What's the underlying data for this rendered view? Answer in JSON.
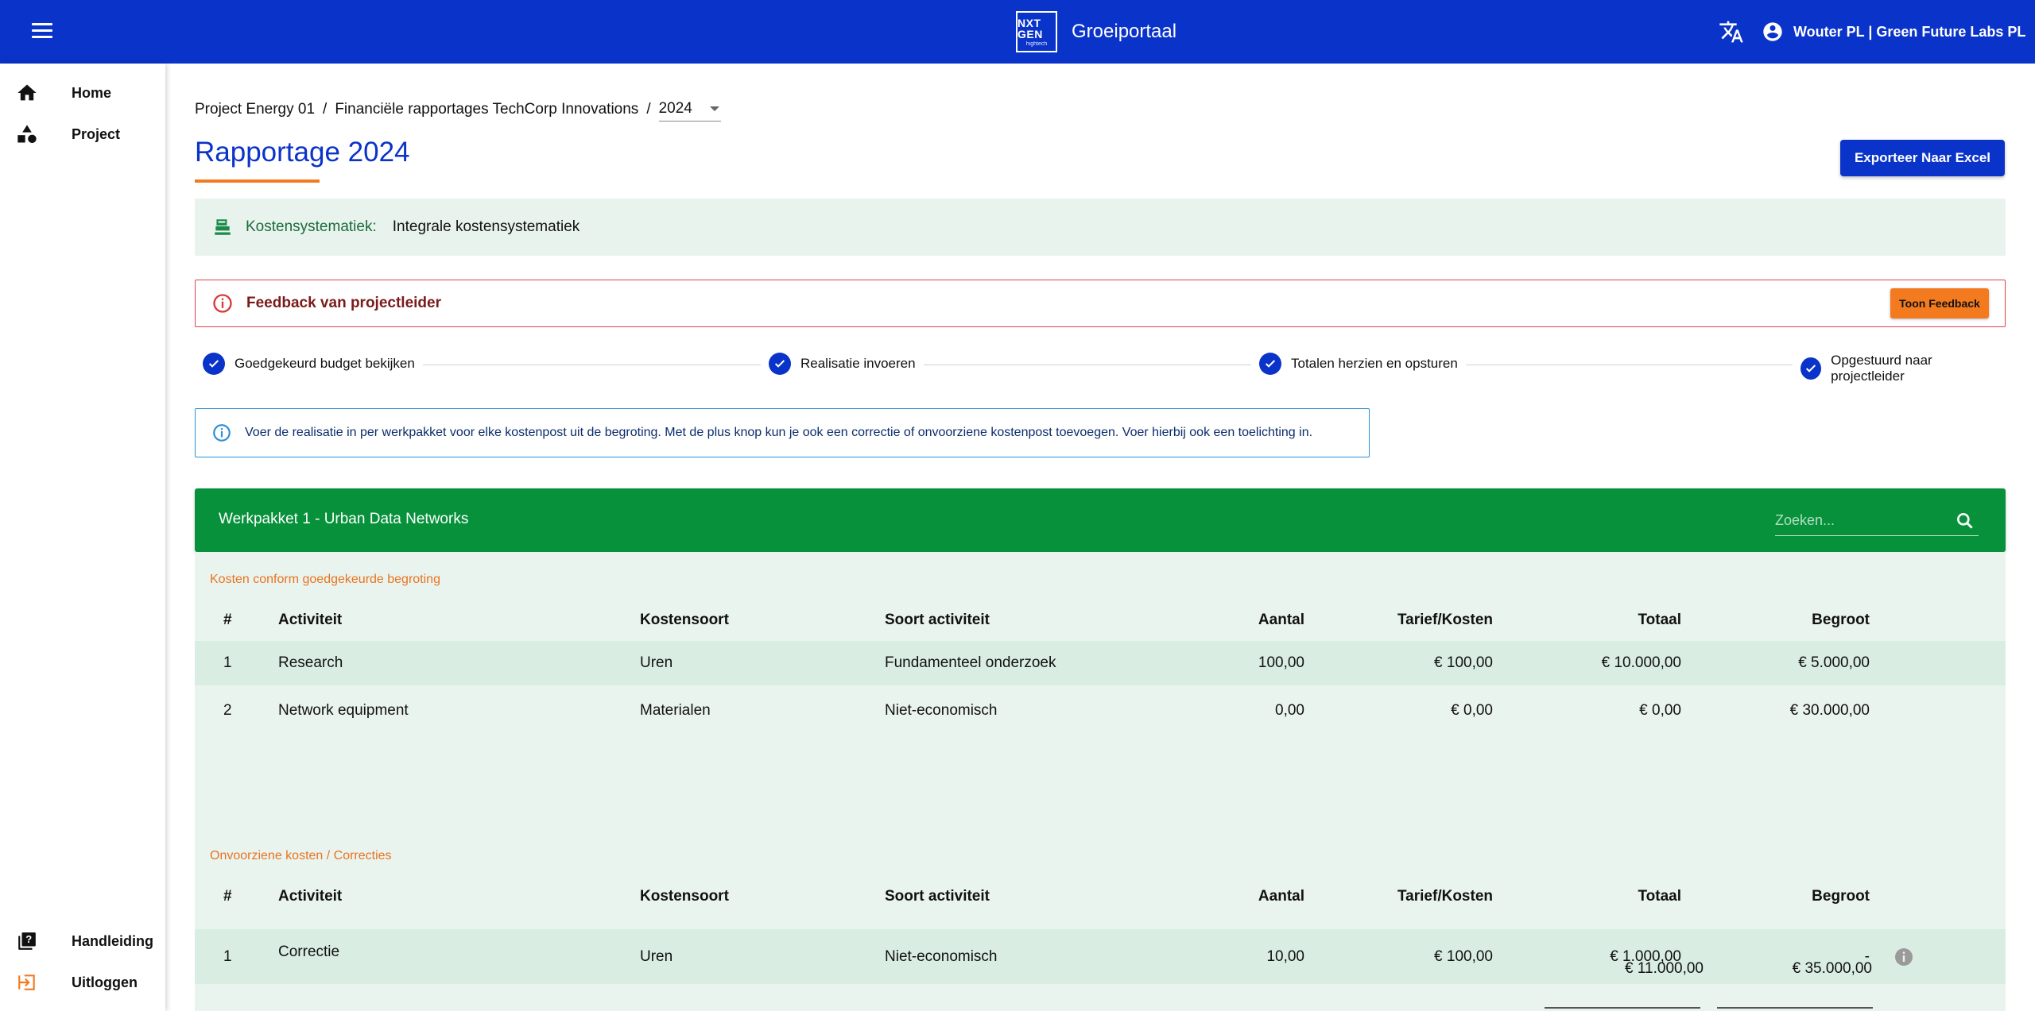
{
  "app": {
    "title": "Groeiportaal",
    "logo_line1": "NXT GEN",
    "logo_line2": "hightech",
    "user": "Wouter PL | Green Future Labs PL"
  },
  "sidebar": {
    "items": [
      {
        "label": "Home",
        "icon": "home-icon"
      },
      {
        "label": "Project",
        "icon": "shapes-icon"
      }
    ],
    "bottom_items": [
      {
        "label": "Handleiding",
        "icon": "help-book-icon"
      },
      {
        "label": "Uitloggen",
        "icon": "logout-icon"
      }
    ]
  },
  "breadcrumb": {
    "project": "Project Energy 01",
    "sep": "/",
    "report": "Financiële rapportages TechCorp Innovations",
    "year": "2024"
  },
  "page": {
    "title": "Rapportage 2024",
    "export_label": "Exporteer Naar Excel"
  },
  "kosten": {
    "label": "Kostensystematiek:",
    "value": "Integrale kostensystematiek"
  },
  "feedback": {
    "title": "Feedback van projectleider",
    "button": "Toon Feedback"
  },
  "steps": [
    {
      "label": "Goedgekeurd budget bekijken"
    },
    {
      "label": "Realisatie invoeren"
    },
    {
      "label": "Totalen herzien en opsturen"
    },
    {
      "label": "Opgestuurd naar projectleider"
    }
  ],
  "info": {
    "text": "Voer de realisatie in per werkpakket voor elke kostenpost uit de begroting. Met de plus knop kun je ook een correctie of onvoorziene kostenpost toevoegen. Voer hierbij ook een toelichting in."
  },
  "workpackage": {
    "title": "Werkpakket 1 - Urban Data Networks",
    "search_placeholder": "Zoeken...",
    "columns": [
      "#",
      "Activiteit",
      "Kostensoort",
      "Soort activiteit",
      "Aantal",
      "Tarief/Kosten",
      "Totaal",
      "Begroot"
    ],
    "section1": {
      "label": "Kosten conform goedgekeurde begroting",
      "rows": [
        {
          "num": "1",
          "activiteit": "Research",
          "kostensoort": "Uren",
          "soort": "Fundamenteel onderzoek",
          "aantal": "100,00",
          "tarief": "€ 100,00",
          "totaal": "€ 10.000,00",
          "begroot": "€ 5.000,00"
        },
        {
          "num": "2",
          "activiteit": "Network equipment",
          "kostensoort": "Materialen",
          "soort": "Niet-economisch",
          "aantal": "0,00",
          "tarief": "€ 0,00",
          "totaal": "€ 0,00",
          "begroot": "€ 30.000,00"
        }
      ]
    },
    "section2": {
      "label": "Onvoorziene kosten / Correcties",
      "rows": [
        {
          "num": "1",
          "activiteit": "Correctie",
          "kostensoort": "Uren",
          "soort": "Niet-economisch",
          "aantal": "10,00",
          "tarief": "€ 100,00",
          "totaal": "€ 1.000,00",
          "begroot": "-"
        }
      ]
    },
    "totals": {
      "totaal": "€ 11.000,00",
      "begroot": "€ 35.000,00"
    }
  },
  "colors": {
    "primary": "#0a33c9",
    "accent_orange": "#f47a20",
    "green_header": "#07913b",
    "light_green": "#eaf4ef",
    "error_red": "#e0404a",
    "info_blue": "#2b8fd6"
  }
}
